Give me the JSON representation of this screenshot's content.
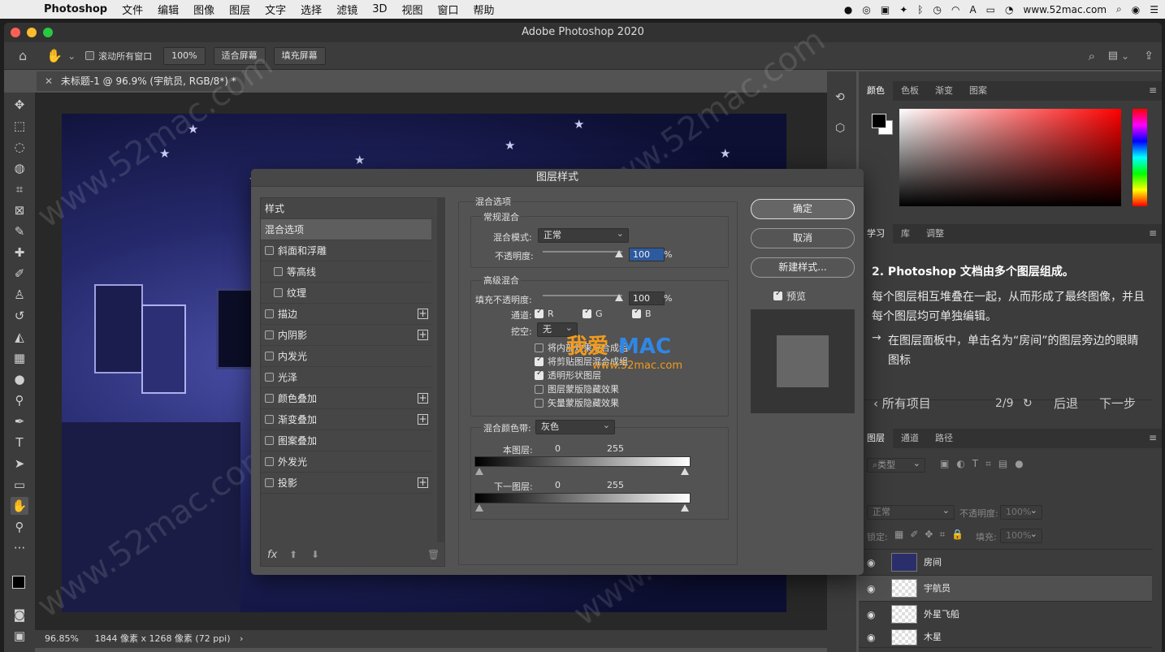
{
  "menubar": {
    "app_name": "Photoshop",
    "items": [
      "文件",
      "编辑",
      "图像",
      "图层",
      "文字",
      "选择",
      "滤镜",
      "3D",
      "视图",
      "窗口",
      "帮助"
    ],
    "site": "www.52mac.com"
  },
  "window": {
    "title": "Adobe Photoshop 2020"
  },
  "options_bar": {
    "scroll_all": "滚动所有窗口",
    "zoom_value": "100%",
    "fit_screen": "适合屏幕",
    "fill_screen": "填充屏幕"
  },
  "document_tab": {
    "label": "未标题-1 @ 96.9% (宇航员, RGB/8*) *"
  },
  "status": {
    "zoom": "96.85%",
    "doc_info": "1844 像素 x 1268 像素 (72 ppi)"
  },
  "color_panel": {
    "tabs": [
      "颜色",
      "色板",
      "渐变",
      "图案"
    ],
    "foreground": "#000000",
    "background": "#ffffff"
  },
  "learn_panel": {
    "tabs": [
      "学习",
      "库",
      "调整"
    ],
    "step_title": "2. Photoshop 文档由多个图层组成。",
    "description": "每个图层相互堆叠在一起，从而形成了最终图像，并且每个图层均可单独编辑。",
    "instruction": "在图层面板中，单击名为“房间”的图层旁边的眼睛图标",
    "all_items": "所有项目",
    "progress": "2/9",
    "back": "后退",
    "next": "下一步"
  },
  "layers_panel": {
    "tabs": [
      "图层",
      "通道",
      "路径"
    ],
    "filter_type": "类型",
    "blend_mode": "正常",
    "opacity_label": "不透明度:",
    "opacity_value": "100%",
    "lock_label": "锁定:",
    "fill_label": "填充:",
    "fill_value": "100%",
    "layers": [
      {
        "name": "房间",
        "selected": false
      },
      {
        "name": "宇航员",
        "selected": true
      },
      {
        "name": "外星飞船",
        "selected": false
      },
      {
        "name": "木星",
        "selected": false
      }
    ]
  },
  "dialog": {
    "title": "图层样式",
    "styles_header": "样式",
    "style_items": [
      {
        "label": "混合选项",
        "checkbox": false,
        "plus": false,
        "active": true,
        "indent": false
      },
      {
        "label": "斜面和浮雕",
        "checkbox": true,
        "plus": false,
        "active": false,
        "indent": false
      },
      {
        "label": "等高线",
        "checkbox": true,
        "plus": false,
        "active": false,
        "indent": true
      },
      {
        "label": "纹理",
        "checkbox": true,
        "plus": false,
        "active": false,
        "indent": true
      },
      {
        "label": "描边",
        "checkbox": true,
        "plus": true,
        "active": false,
        "indent": false
      },
      {
        "label": "内阴影",
        "checkbox": true,
        "plus": true,
        "active": false,
        "indent": false
      },
      {
        "label": "内发光",
        "checkbox": true,
        "plus": false,
        "active": false,
        "indent": false
      },
      {
        "label": "光泽",
        "checkbox": true,
        "plus": false,
        "active": false,
        "indent": false
      },
      {
        "label": "颜色叠加",
        "checkbox": true,
        "plus": true,
        "active": false,
        "indent": false
      },
      {
        "label": "渐变叠加",
        "checkbox": true,
        "plus": true,
        "active": false,
        "indent": false
      },
      {
        "label": "图案叠加",
        "checkbox": true,
        "plus": false,
        "active": false,
        "indent": false
      },
      {
        "label": "外发光",
        "checkbox": true,
        "plus": false,
        "active": false,
        "indent": false
      },
      {
        "label": "投影",
        "checkbox": true,
        "plus": true,
        "active": false,
        "indent": false
      }
    ],
    "blend_options": "混合选项",
    "general_blend": "常规混合",
    "blend_mode_label": "混合模式:",
    "blend_mode_value": "正常",
    "opacity_label": "不透明度:",
    "opacity_value": "100",
    "percent": "%",
    "advanced_blend": "高级混合",
    "fill_opacity_label": "填充不透明度:",
    "fill_opacity_value": "100",
    "channels_label": "通道:",
    "channel_r": "R",
    "channel_g": "G",
    "channel_b": "B",
    "knockout_label": "挖空:",
    "knockout_value": "无",
    "adv_options": [
      {
        "label": "将内部效果混合成组",
        "checked": false
      },
      {
        "label": "将剪贴图层混合成组",
        "checked": true
      },
      {
        "label": "透明形状图层",
        "checked": true
      },
      {
        "label": "图层蒙版隐藏效果",
        "checked": false
      },
      {
        "label": "矢量蒙版隐藏效果",
        "checked": false
      }
    ],
    "blend_if_label": "混合颜色带:",
    "blend_if_value": "灰色",
    "this_layer": "本图层:",
    "underlying_layer": "下一图层:",
    "range_min": "0",
    "range_max": "255",
    "ok": "确定",
    "cancel": "取消",
    "new_style": "新建样式...",
    "preview": "预览",
    "fx": "fx"
  },
  "watermark": {
    "text": "www.52mac.com",
    "logo_cn": "我爱",
    "logo_en": "MAC",
    "logo_url": "www.52mac.com"
  }
}
